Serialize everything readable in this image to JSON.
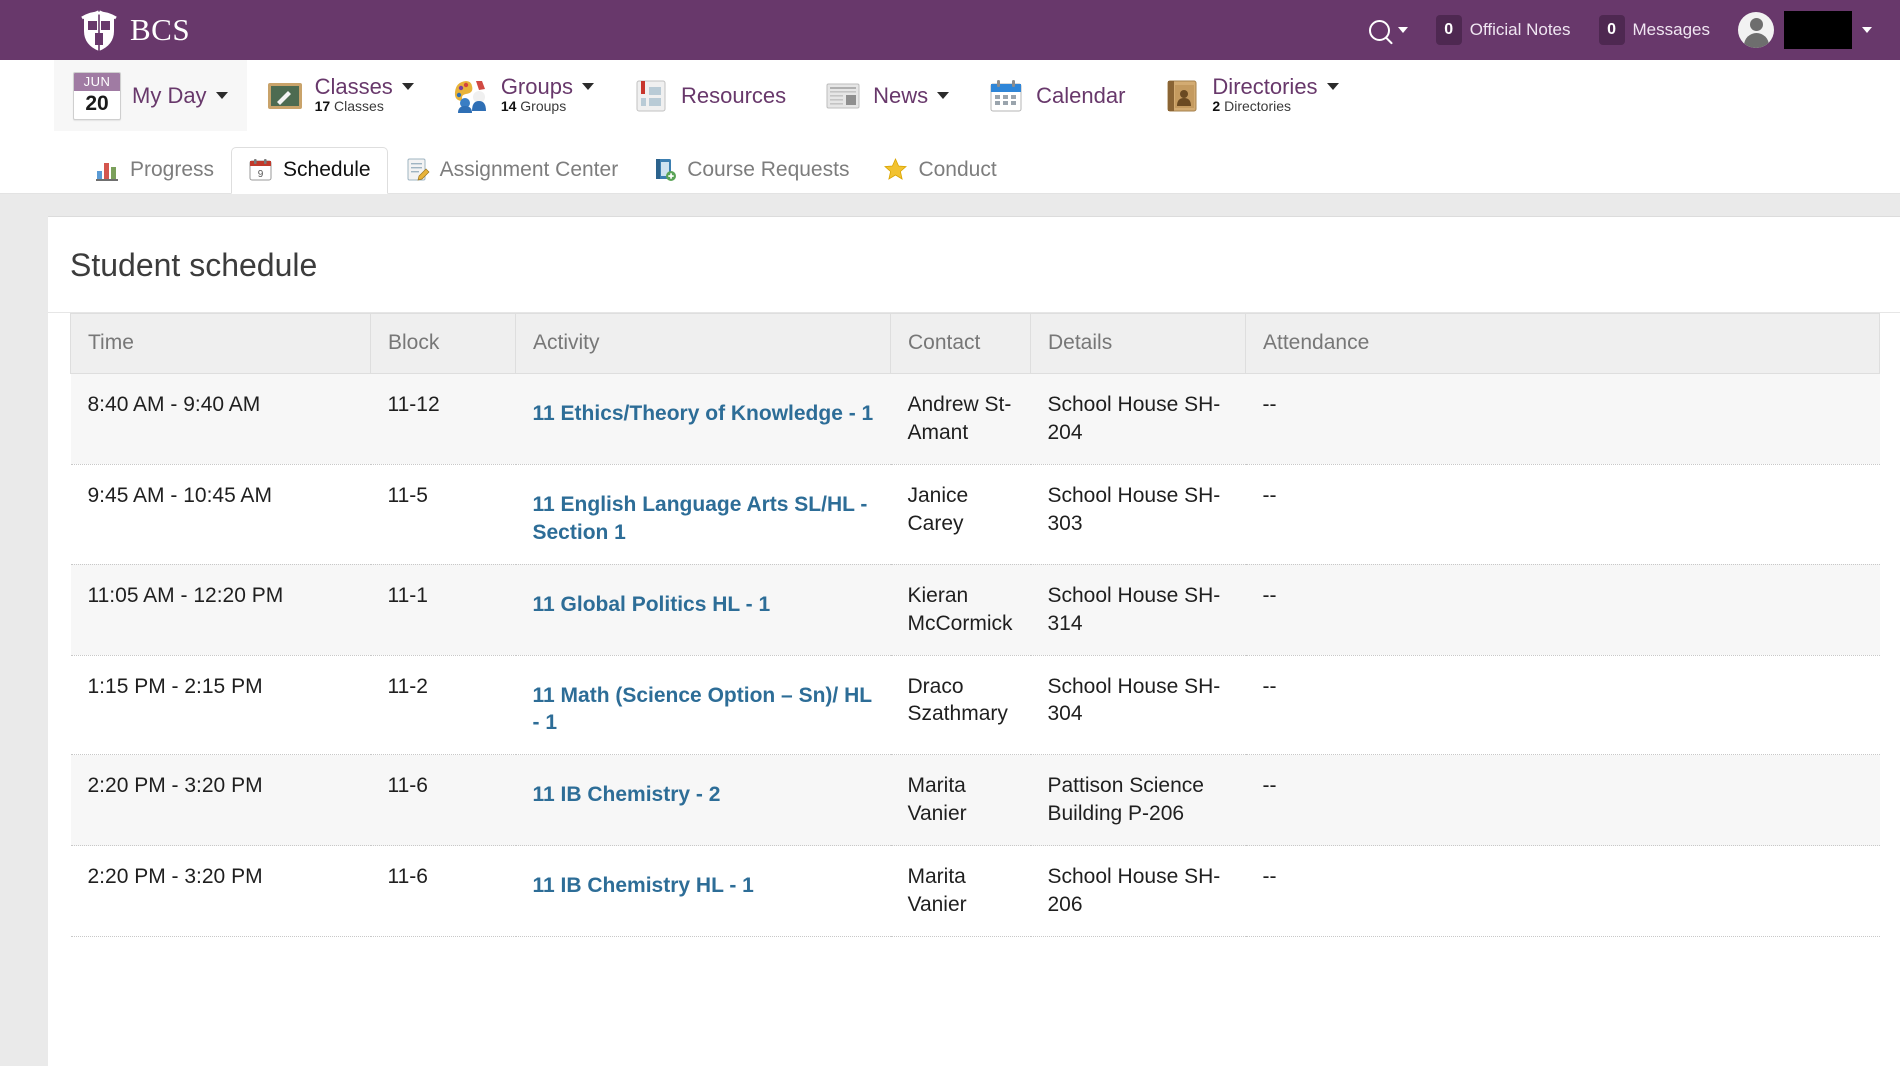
{
  "topbar": {
    "brand": "BCS",
    "logo_icon": "bcs-shield-crest-icon",
    "search_icon": "search-icon",
    "search_caret_icon": "chevron-down-icon",
    "official_notes": {
      "count": "0",
      "label": "Official Notes"
    },
    "messages": {
      "count": "0",
      "label": "Messages"
    },
    "user": {
      "avatar_icon": "user-avatar-icon",
      "name": "",
      "caret_icon": "chevron-down-icon"
    },
    "background_color": "#68386b"
  },
  "mainnav": {
    "items": [
      {
        "label": "My Day",
        "sub_count": "",
        "sub_label": "",
        "icon": "calendar-date-icon",
        "has_caret": true,
        "date_month": "JUN",
        "date_day": "20",
        "active": true
      },
      {
        "label": "Classes",
        "sub_count": "17",
        "sub_label": "Classes",
        "icon": "chalkboard-icon",
        "has_caret": true
      },
      {
        "label": "Groups",
        "sub_count": "14",
        "sub_label": "Groups",
        "icon": "groups-palette-icon",
        "has_caret": true
      },
      {
        "label": "Resources",
        "sub_count": "",
        "sub_label": "",
        "icon": "resources-book-icon",
        "has_caret": false
      },
      {
        "label": "News",
        "sub_count": "",
        "sub_label": "",
        "icon": "newspaper-icon",
        "has_caret": true
      },
      {
        "label": "Calendar",
        "sub_count": "",
        "sub_label": "",
        "icon": "calendar-icon",
        "has_caret": false
      },
      {
        "label": "Directories",
        "sub_count": "2",
        "sub_label": "Directories",
        "icon": "address-book-icon",
        "has_caret": true
      }
    ]
  },
  "subnav": {
    "tabs": [
      {
        "label": "Progress",
        "icon": "bar-chart-icon",
        "active": false
      },
      {
        "label": "Schedule",
        "icon": "calendar-schedule-icon",
        "active": true
      },
      {
        "label": "Assignment Center",
        "icon": "notepad-pencil-icon",
        "active": false
      },
      {
        "label": "Course Requests",
        "icon": "book-add-icon",
        "active": false
      },
      {
        "label": "Conduct",
        "icon": "star-icon",
        "active": false
      }
    ]
  },
  "main": {
    "title": "Student schedule",
    "table": {
      "columns": [
        "Time",
        "Block",
        "Activity",
        "Contact",
        "Details",
        "Attendance"
      ],
      "rows": [
        {
          "time": "8:40 AM - 9:40 AM",
          "block": "11-12",
          "activity": "11 Ethics/Theory of Knowledge - 1",
          "contact": "Andrew St-Amant",
          "details": "School House SH-204",
          "attendance": "--"
        },
        {
          "time": "9:45 AM - 10:45 AM",
          "block": "11-5",
          "activity": "11 English Language Arts SL/HL - Section 1",
          "contact": "Janice Carey",
          "details": "School House SH-303",
          "attendance": "--"
        },
        {
          "time": "11:05 AM - 12:20 PM",
          "block": "11-1",
          "activity": "11 Global Politics HL - 1",
          "contact": "Kieran McCormick",
          "details": "School House SH-314",
          "attendance": "--"
        },
        {
          "time": "1:15 PM - 2:15 PM",
          "block": "11-2",
          "activity": "11 Math (Science Option – Sn)/ HL - 1",
          "contact": "Draco Szathmary",
          "details": "School House SH-304",
          "attendance": "--"
        },
        {
          "time": "2:20 PM - 3:20 PM",
          "block": "11-6",
          "activity": "11 IB Chemistry - 2",
          "contact": "Marita Vanier",
          "details": "Pattison Science Building P-206",
          "attendance": "--"
        },
        {
          "time": "2:20 PM - 3:20 PM",
          "block": "11-6",
          "activity": "11 IB Chemistry HL - 1",
          "contact": "Marita Vanier",
          "details": "School House SH-206",
          "attendance": "--"
        }
      ]
    }
  },
  "colors": {
    "brand_purple": "#68386b",
    "link_blue": "#2d6d97",
    "page_bg": "#eaeaea",
    "header_row_bg": "#efefef"
  }
}
